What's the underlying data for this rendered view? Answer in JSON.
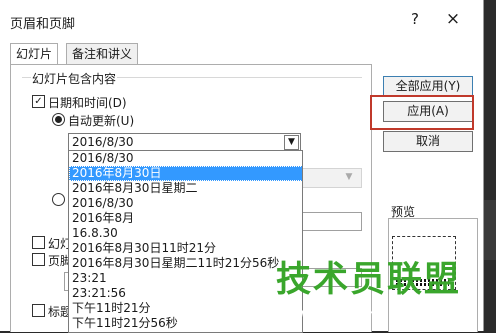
{
  "dialog": {
    "title": "页眉和页脚",
    "help_label": "?",
    "close_label": "×"
  },
  "tabs": [
    {
      "label": "幻灯片"
    },
    {
      "label": "备注和讲义"
    }
  ],
  "slide_group": {
    "label": "幻灯片包含内容",
    "date_time": {
      "label": "日期和时间(D)",
      "checked": true
    },
    "auto_update": {
      "label": "自动更新(U)",
      "selected": true
    },
    "date_format_value": "2016/8/30",
    "slide_number_partial": "幻灯",
    "footer_partial": "页脚",
    "title_slide_partial": "标题"
  },
  "date_format_options": [
    "2016/8/30",
    "2016年8月30日",
    "2016年8月30日星期二",
    "2016/8/30",
    "2016年8月",
    "16.8.30",
    "2016年8月30日11时21分",
    "2016年8月30日星期二11时21分56秒",
    "23:21",
    "23:21:56",
    "下午11时21分",
    "下午11时21分56秒"
  ],
  "selected_option_index": 1,
  "buttons": {
    "apply_all": "全部应用(Y)",
    "apply": "应用(A)",
    "cancel": "取消"
  },
  "preview": {
    "label": "预览"
  },
  "watermark": {
    "text": "技术员联盟",
    "url": "www.jsgho.com"
  },
  "colors": {
    "selection": "#3399ff",
    "highlight_box": "#c0392b",
    "watermark": "#3aa62c"
  }
}
